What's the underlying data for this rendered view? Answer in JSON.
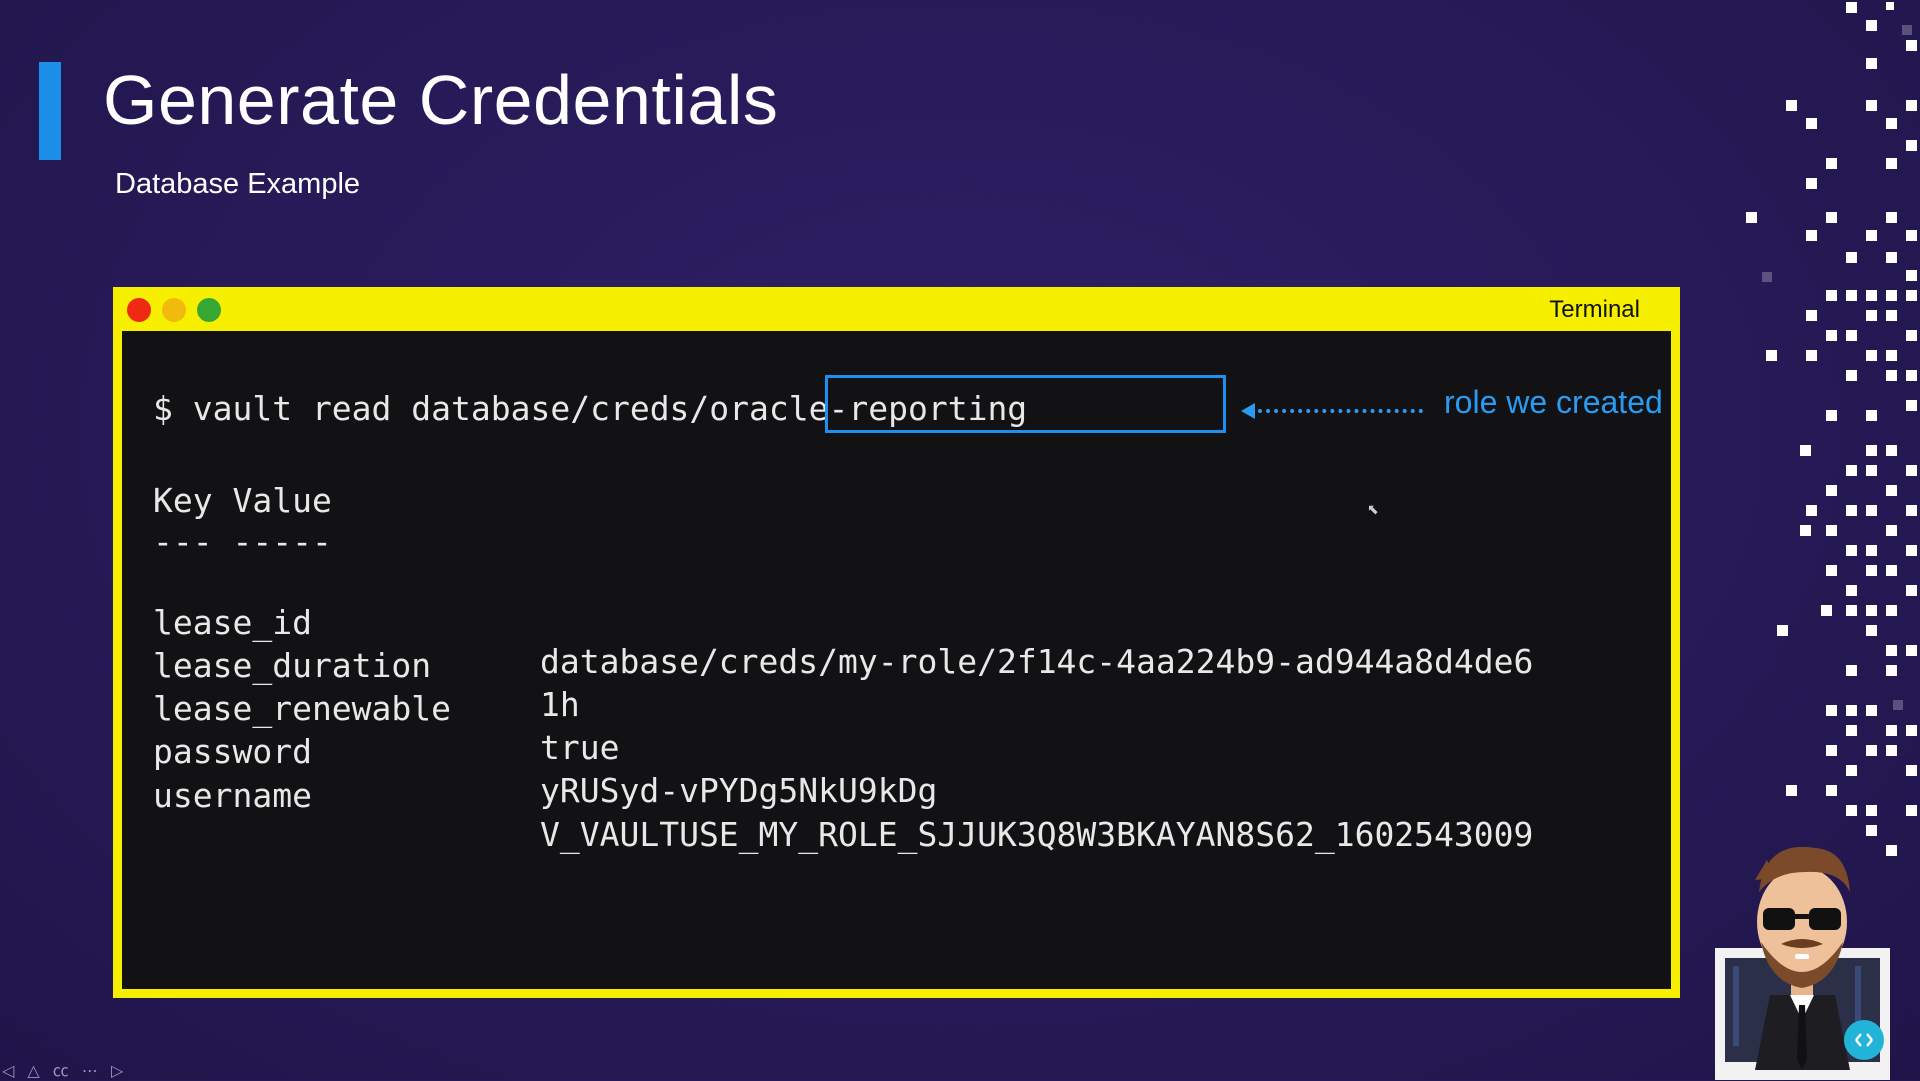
{
  "slide": {
    "title": "Generate Credentials",
    "subtitle": "Database Example"
  },
  "terminal": {
    "window_title": "Terminal",
    "command_prefix": "$ vault read database/creds/",
    "command_role": "oracle-reporting",
    "annotation": "role we created",
    "header": "Key Value",
    "separator": "--- -----",
    "rows": [
      {
        "key": "lease_id",
        "value": "database/creds/my-role/2f14c-4aa224b9-ad944a8d4de6"
      },
      {
        "key": "lease_duration",
        "value": "1h"
      },
      {
        "key": "lease_renewable",
        "value": "true"
      },
      {
        "key": "password",
        "value": "yRUSyd-vPYDg5NkU9kDg"
      },
      {
        "key": "username",
        "value": "V_VAULTUSE_MY_ROLE_SJJUK3Q8W3BKAYAN8S62_1602543009"
      }
    ]
  },
  "colors": {
    "background": "#271a58",
    "accent": "#1d8fe8",
    "terminal_frame": "#f6f000",
    "annotation": "#2a9bf2"
  },
  "icons": {
    "close": "close-dot-icon",
    "minimize": "minimize-dot-icon",
    "maximize": "maximize-dot-icon",
    "arrow": "arrow-left-icon"
  },
  "player": {
    "controls": "◁ △ ㏄ ⋯ ▷"
  }
}
